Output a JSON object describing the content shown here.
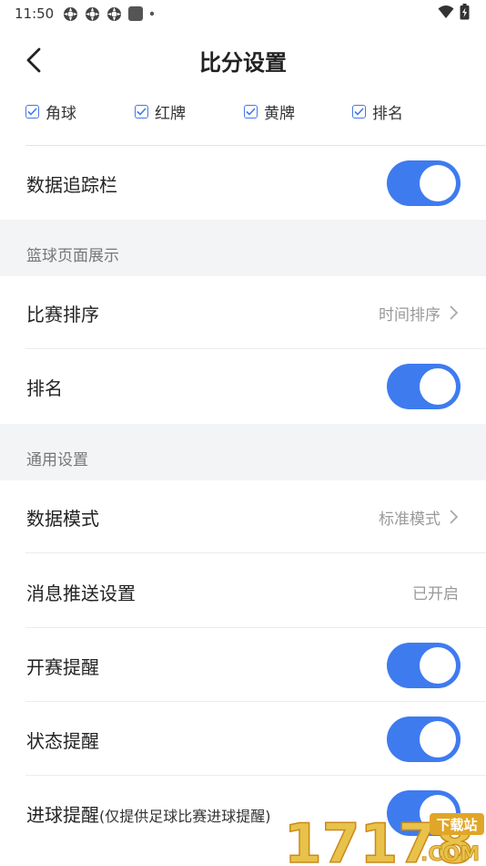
{
  "status_bar": {
    "time": "11:50"
  },
  "header": {
    "title": "比分设置"
  },
  "checkboxes": [
    {
      "label": "角球"
    },
    {
      "label": "红牌"
    },
    {
      "label": "黄牌"
    },
    {
      "label": "排名"
    }
  ],
  "rows": {
    "data_tracker": {
      "label": "数据追踪栏"
    },
    "match_sort": {
      "label": "比赛排序",
      "value": "时间排序"
    },
    "ranking": {
      "label": "排名"
    },
    "data_mode": {
      "label": "数据模式",
      "value": "标准模式"
    },
    "push_settings": {
      "label": "消息推送设置",
      "value": "已开启"
    },
    "match_start_reminder": {
      "label": "开赛提醒"
    },
    "status_reminder": {
      "label": "状态提醒"
    },
    "goal_reminder": {
      "label": "进球提醒",
      "sub": "(仅提供足球比赛进球提醒)"
    }
  },
  "sections": {
    "basketball": "篮球页面展示",
    "general": "通用设置"
  },
  "watermark": {
    "number": "17178",
    "badge": "下载站",
    "domain": ".COM"
  },
  "colors": {
    "accent": "#3e7bef",
    "section_bg": "#f3f4f6",
    "muted_text": "#999999"
  }
}
